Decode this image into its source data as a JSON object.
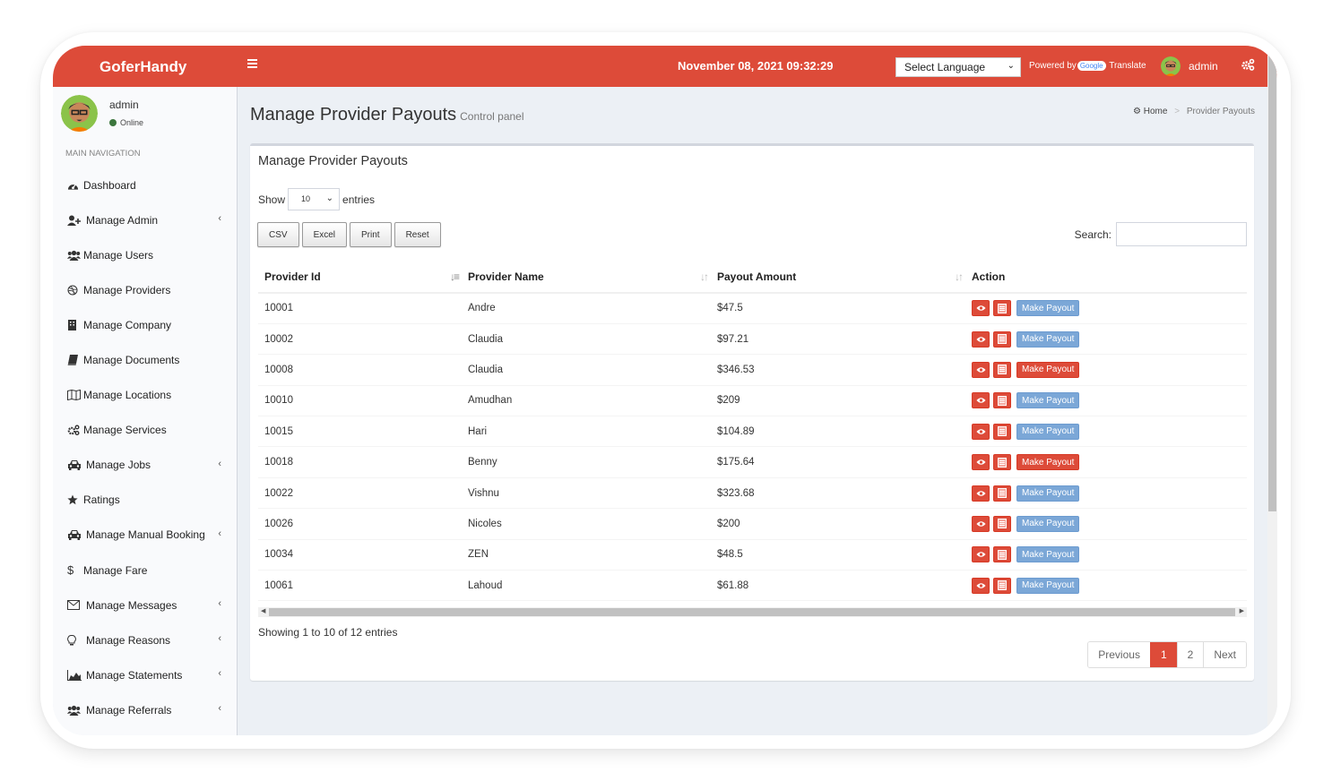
{
  "header": {
    "brand": "GoferHandy",
    "clock": "November 08, 2021 09:32:29",
    "language_select": "Select Language",
    "powered_by": "Powered by",
    "google": "Google",
    "translate": "Translate",
    "user": "admin",
    "brand_color": "#dd4b39"
  },
  "sidebar": {
    "user_name": "admin",
    "status": "Online",
    "nav_header": "MAIN NAVIGATION",
    "items": [
      {
        "label": "Dashboard",
        "icon": "dashboard-icon",
        "has_submenu": false
      },
      {
        "label": "Manage Admin",
        "icon": "user-plus-icon",
        "has_submenu": true
      },
      {
        "label": "Manage Users",
        "icon": "users-icon",
        "has_submenu": false
      },
      {
        "label": "Manage Providers",
        "icon": "dribbble-icon",
        "has_submenu": false
      },
      {
        "label": "Manage Company",
        "icon": "building-icon",
        "has_submenu": false
      },
      {
        "label": "Manage Documents",
        "icon": "book-icon",
        "has_submenu": false
      },
      {
        "label": "Manage Locations",
        "icon": "map-icon",
        "has_submenu": false
      },
      {
        "label": "Manage Services",
        "icon": "cogs-icon",
        "has_submenu": false
      },
      {
        "label": "Manage Jobs",
        "icon": "taxi-icon",
        "has_submenu": true
      },
      {
        "label": "Ratings",
        "icon": "star-icon",
        "has_submenu": false
      },
      {
        "label": "Manage Manual Booking",
        "icon": "taxi-icon",
        "has_submenu": true
      },
      {
        "label": "Manage Fare",
        "icon": "dollar-icon",
        "has_submenu": false
      },
      {
        "label": "Manage Messages",
        "icon": "envelope-icon",
        "has_submenu": true
      },
      {
        "label": "Manage Reasons",
        "icon": "lightbulb-icon",
        "has_submenu": true
      },
      {
        "label": "Manage Statements",
        "icon": "area-chart-icon",
        "has_submenu": true
      },
      {
        "label": "Manage Referrals",
        "icon": "users-icon",
        "has_submenu": true
      }
    ]
  },
  "page": {
    "title": "Manage Provider Payouts",
    "subtitle": "Control panel",
    "breadcrumb_home": "Home",
    "breadcrumb_current": "Provider Payouts",
    "box_title": "Manage Provider Payouts",
    "show_label": "Show",
    "page_length": "10",
    "entries_label": "entries",
    "buttons": [
      "CSV",
      "Excel",
      "Print",
      "Reset"
    ],
    "search_label": "Search:",
    "search_value": ""
  },
  "table": {
    "columns": [
      "Provider Id",
      "Provider Name",
      "Payout Amount",
      "Action"
    ],
    "rows": [
      {
        "id": "10001",
        "name": "Andre",
        "amount": "$47.5",
        "payout_style": "blue"
      },
      {
        "id": "10002",
        "name": "Claudia",
        "amount": "$97.21",
        "payout_style": "blue"
      },
      {
        "id": "10008",
        "name": "Claudia",
        "amount": "$346.53",
        "payout_style": "red"
      },
      {
        "id": "10010",
        "name": "Amudhan",
        "amount": "$209",
        "payout_style": "blue"
      },
      {
        "id": "10015",
        "name": "Hari",
        "amount": "$104.89",
        "payout_style": "blue"
      },
      {
        "id": "10018",
        "name": "Benny",
        "amount": "$175.64",
        "payout_style": "red"
      },
      {
        "id": "10022",
        "name": "Vishnu",
        "amount": "$323.68",
        "payout_style": "blue"
      },
      {
        "id": "10026",
        "name": "Nicoles",
        "amount": "$200",
        "payout_style": "blue"
      },
      {
        "id": "10034",
        "name": "ZEN",
        "amount": "$48.5",
        "payout_style": "blue"
      },
      {
        "id": "10061",
        "name": "Lahoud",
        "amount": "$61.88",
        "payout_style": "blue"
      }
    ],
    "make_payout_label": "Make Payout",
    "info": "Showing 1 to 10 of 12 entries"
  },
  "pagination": {
    "previous": "Previous",
    "pages": [
      "1",
      "2"
    ],
    "active_page": "1",
    "next": "Next"
  }
}
